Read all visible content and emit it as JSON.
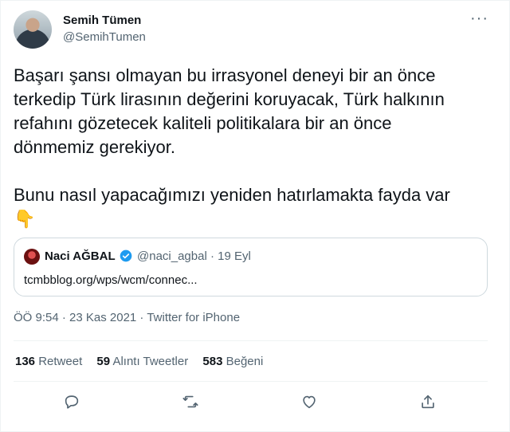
{
  "author": {
    "name": "Semih Tümen",
    "handle": "@SemihTumen"
  },
  "more_label": "···",
  "tweet": {
    "line1": "Başarı şansı olmayan bu irrasyonel deneyi bir an önce",
    "line2": "terkedip Türk lirasının değerini koruyacak, Türk halkının",
    "line3": "refahını gözetecek kaliteli politikalara bir an önce",
    "line4": "dönmemiz gerekiyor.",
    "line5": "Bunu nasıl yapacağımızı yeniden hatırlamakta fayda var",
    "emoji": "👇"
  },
  "quote": {
    "name": "Naci AĞBAL",
    "handle_date": "@naci_agbal · 19 Eyl",
    "link": "tcmbblog.org/wps/wcm/connec..."
  },
  "meta": "ÖÖ 9:54 · 23 Kas 2021 · Twitter for iPhone",
  "stats": {
    "retweets_count": "136",
    "retweets_label": "Retweet",
    "quotes_count": "59",
    "quotes_label": "Alıntı Tweetler",
    "likes_count": "583",
    "likes_label": "Beğeni"
  },
  "icons": {
    "reply": "reply-icon",
    "retweet": "retweet-icon",
    "like": "heart-icon",
    "share": "share-icon"
  },
  "colors": {
    "text": "#0f1419",
    "secondary": "#536471",
    "border": "#cfd9de",
    "verified": "#1d9bf0"
  }
}
